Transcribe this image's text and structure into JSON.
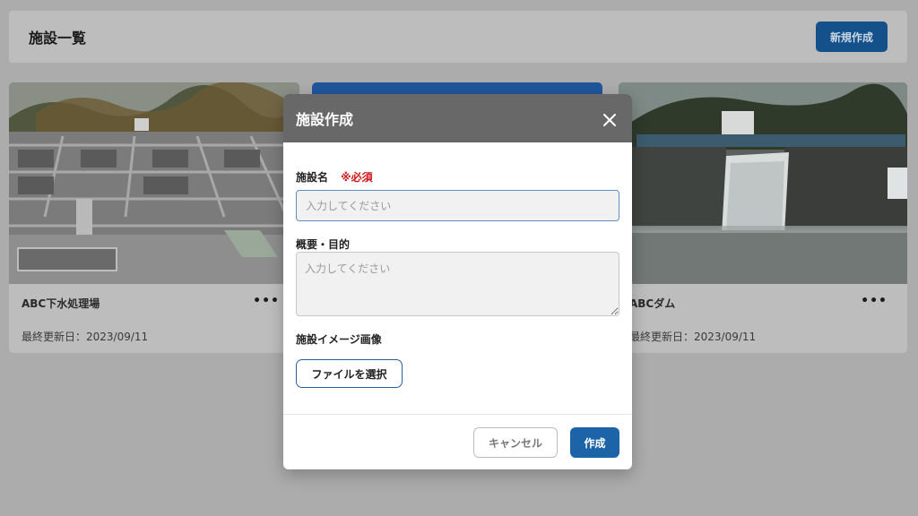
{
  "header": {
    "title": "施設一覧",
    "new_button": "新規作成"
  },
  "facilities": [
    {
      "name": "ABC下水処理場",
      "updated": "最終更新日：2023/09/11",
      "more": "•••"
    },
    {
      "name": "",
      "updated": "",
      "more": ""
    },
    {
      "name": "ABCダム",
      "updated": "最終更新日：2023/09/11",
      "more": "•••"
    }
  ],
  "modal": {
    "title": "施設作成",
    "close_icon": "close-icon",
    "name_label": "施設名",
    "required_mark": "※必須",
    "name_placeholder": "入力してください",
    "desc_label": "概要・目的",
    "desc_placeholder": "入力してください",
    "image_label": "施設イメージ画像",
    "file_button": "ファイルを選択",
    "cancel_button": "キャンセル",
    "create_button": "作成"
  },
  "colors": {
    "overlay": "#acacac",
    "modal_header": "#686868",
    "primary": "#1c63a8",
    "required": "#d0181b"
  }
}
